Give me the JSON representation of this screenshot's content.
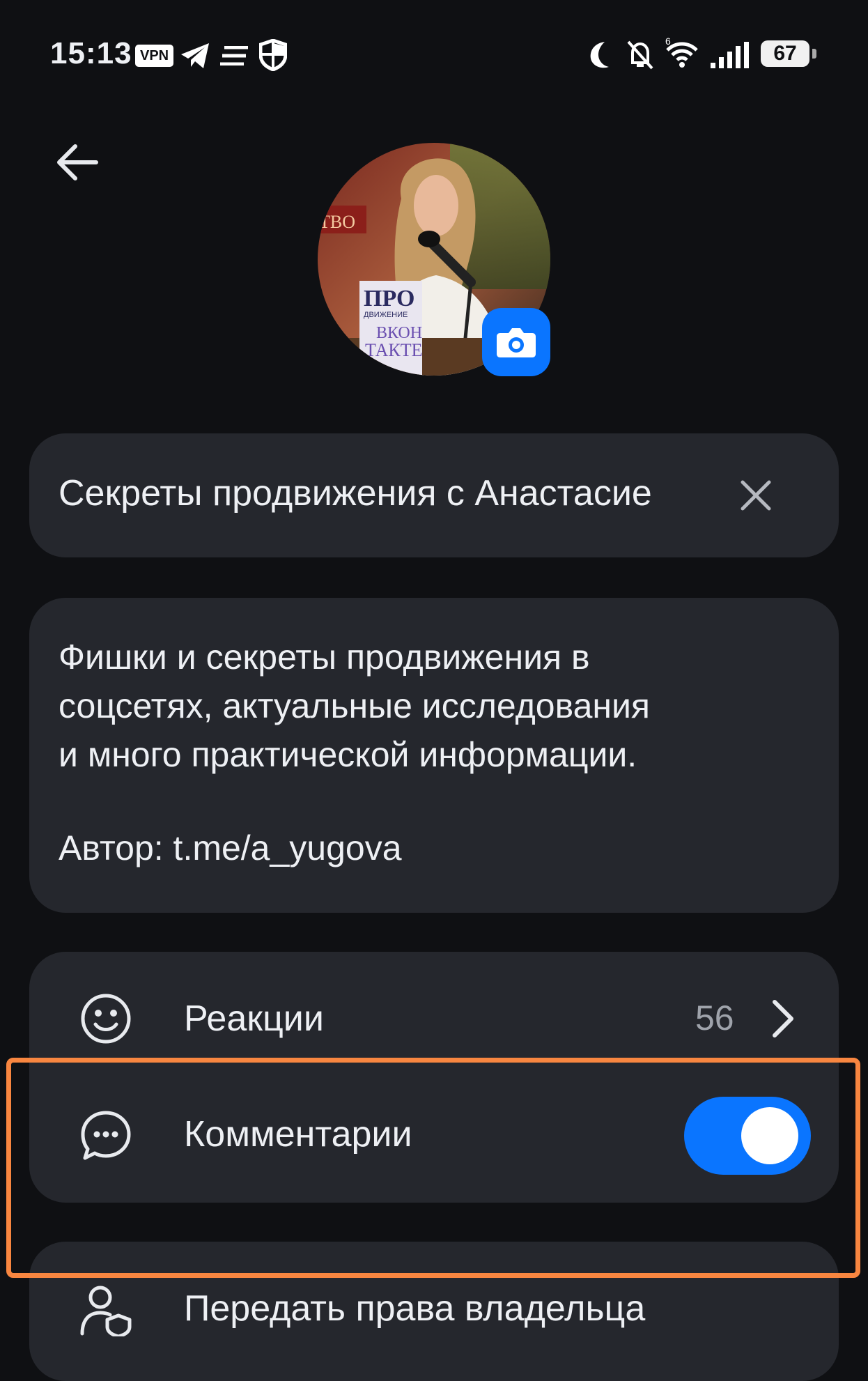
{
  "status_bar": {
    "time": "15:13",
    "vpn_label": "VPN",
    "battery": "67",
    "wifi_generation": "6"
  },
  "channel": {
    "name": "Секреты продвижения с Анастасие",
    "description_lines": [
      "Фишки и секреты продвижения в",
      "соцсетях, актуальные исследования",
      "и много практической информации."
    ],
    "author": "Автор: t.me/a_yugova"
  },
  "avatar_text": {
    "book_title": "ПРО",
    "book_line2": "ДВИЖЕНИЕ",
    "book_line3": "ВКОН",
    "book_line4": "ТАКТЕ",
    "banner_fragment": "ТВО"
  },
  "settings": {
    "reactions": {
      "label": "Реакции",
      "count": "56"
    },
    "comments": {
      "label": "Комментарии",
      "enabled": true
    },
    "transfer_owner": {
      "label": "Передать права владельца"
    }
  },
  "colors": {
    "accent": "#0a75ff",
    "highlight": "#f88640",
    "card": "#25272d",
    "background": "#0f1013"
  }
}
